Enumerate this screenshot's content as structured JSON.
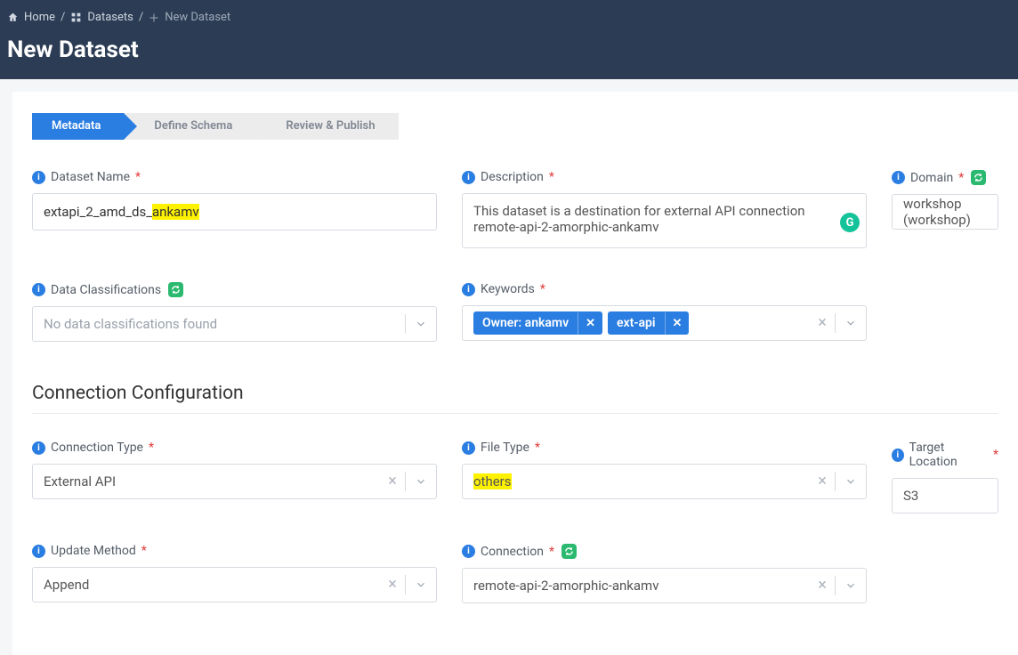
{
  "breadcrumb": {
    "home": "Home",
    "datasets": "Datasets",
    "current": "New Dataset"
  },
  "page_title": "New Dataset",
  "stepper": {
    "metadata": "Metadata",
    "define_schema": "Define Schema",
    "review_publish": "Review & Publish"
  },
  "labels": {
    "dataset_name": "Dataset Name",
    "description": "Description",
    "domain": "Domain",
    "data_classifications": "Data Classifications",
    "keywords": "Keywords",
    "connection_type": "Connection Type",
    "file_type": "File Type",
    "target_location": "Target Location",
    "update_method": "Update Method",
    "connection": "Connection"
  },
  "values": {
    "dataset_name_prefix": "extapi_2_amd_ds_",
    "dataset_name_highlight": "ankamv",
    "description": "This dataset is a destination for external API connection remote-api-2-amorphic-ankamv",
    "domain": "workshop (workshop)",
    "data_classifications_placeholder": "No data classifications found",
    "keywords": [
      "Owner: ankamv",
      "ext-api"
    ],
    "connection_type": "External API",
    "file_type": "others",
    "target_location": "S3",
    "update_method": "Append",
    "connection": "remote-api-2-amorphic-ankamv"
  },
  "section_titles": {
    "connection_config": "Connection Configuration"
  }
}
